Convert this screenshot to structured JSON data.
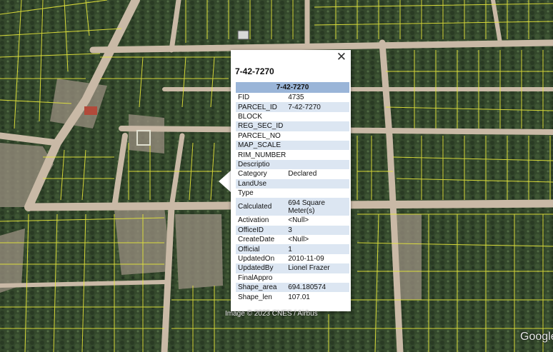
{
  "map": {
    "credit": "Image © 2023 CNES / Airbus",
    "watermark": "Google"
  },
  "popup": {
    "title": "7-42-7270",
    "header": "7-42-7270",
    "close_symbol": "✕",
    "rows": [
      {
        "key": "FID",
        "value": "4735"
      },
      {
        "key": "PARCEL_ID",
        "value": "7-42-7270"
      },
      {
        "key": "BLOCK",
        "value": ""
      },
      {
        "key": "REG_SEC_ID",
        "value": ""
      },
      {
        "key": "PARCEL_NO",
        "value": ""
      },
      {
        "key": "MAP_SCALE",
        "value": ""
      },
      {
        "key": "RIM_NUMBER",
        "value": ""
      },
      {
        "key": "Descriptio",
        "value": ""
      },
      {
        "key": "Category",
        "value": "Declared"
      },
      {
        "key": "LandUse",
        "value": ""
      },
      {
        "key": "Type",
        "value": ""
      },
      {
        "key": "Calculated",
        "value": "694 Square Meter(s)"
      },
      {
        "key": "Activation",
        "value": "<Null>"
      },
      {
        "key": "OfficeID",
        "value": "3"
      },
      {
        "key": "CreateDate",
        "value": "<Null>"
      },
      {
        "key": "Official",
        "value": "1"
      },
      {
        "key": "UpdatedOn",
        "value": "2010-11-09"
      },
      {
        "key": "UpdatedBy",
        "value": "Lionel Frazer"
      },
      {
        "key": "FinalAppro",
        "value": ""
      },
      {
        "key": "Shape_area",
        "value": "694.180574"
      },
      {
        "key": "Shape_len",
        "value": "107.01"
      }
    ]
  },
  "colors": {
    "vegetation": "#34482c",
    "road": "#c9b9a6",
    "parcel_line": "#e8e83a",
    "header_row": "#9ab5d8",
    "alt_row": "#dce6f2"
  }
}
